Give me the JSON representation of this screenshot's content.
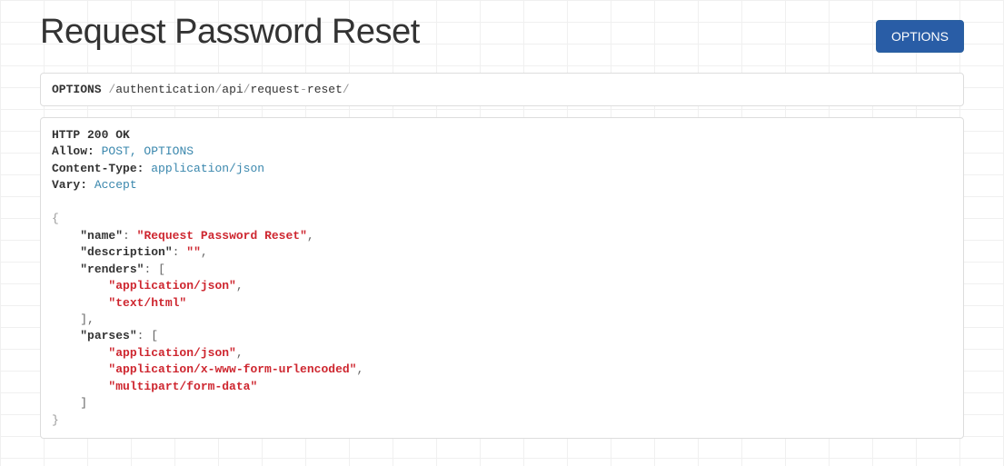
{
  "page_title": "Request Password Reset",
  "options_button_label": "OPTIONS",
  "request_line": {
    "method": "OPTIONS",
    "path_segments": [
      "authentication",
      "api",
      "request",
      "-",
      "reset"
    ],
    "raw_path": "/authentication/api/request-reset/"
  },
  "response": {
    "status_line": "HTTP 200 OK",
    "headers": {
      "allow_key": "Allow:",
      "allow_value": "POST, OPTIONS",
      "content_type_key": "Content-Type:",
      "content_type_value": "application/json",
      "vary_key": "Vary:",
      "vary_value": "Accept"
    },
    "body": {
      "name_key": "\"name\"",
      "name_value": "\"Request Password Reset\"",
      "description_key": "\"description\"",
      "description_value": "\"\"",
      "renders_key": "\"renders\"",
      "renders_values": [
        "\"application/json\"",
        "\"text/html\""
      ],
      "parses_key": "\"parses\"",
      "parses_values": [
        "\"application/json\"",
        "\"application/x-www-form-urlencoded\"",
        "\"multipart/form-data\""
      ]
    }
  }
}
